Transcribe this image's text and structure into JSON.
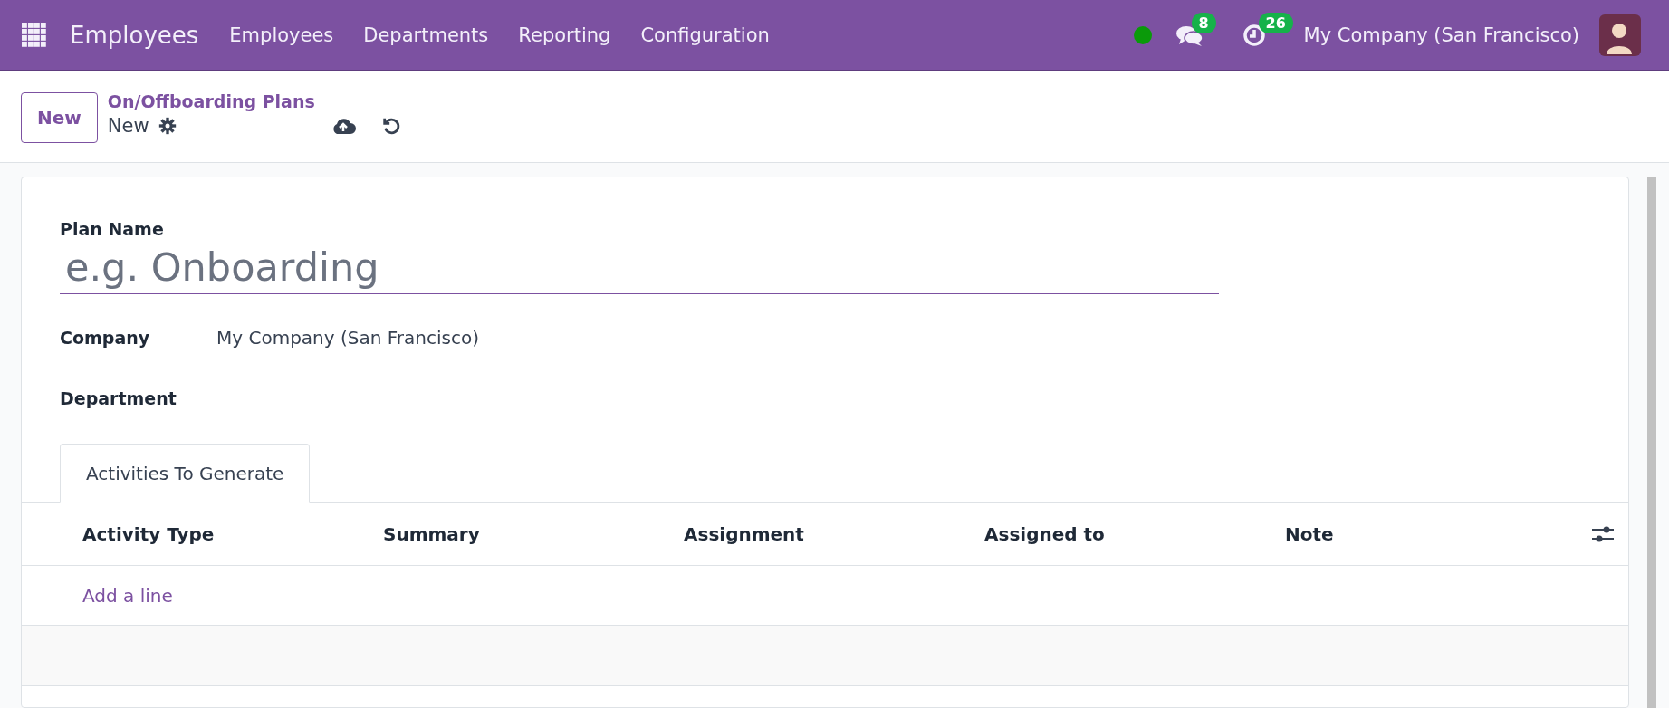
{
  "navbar": {
    "app_name": "Employees",
    "menu": [
      "Employees",
      "Departments",
      "Reporting",
      "Configuration"
    ],
    "messages_count": "8",
    "activities_count": "26",
    "company": "My Company (San Francisco)"
  },
  "control_panel": {
    "new_button": "New",
    "breadcrumb": "On/Offboarding Plans",
    "record": "New"
  },
  "form": {
    "plan_name": {
      "label": "Plan Name",
      "placeholder": "e.g. Onboarding"
    },
    "fields": [
      {
        "label": "Company",
        "value": "My Company (San Francisco)"
      },
      {
        "label": "Department"
      }
    ],
    "tabs": [
      {
        "label": "Activities To Generate",
        "selected": true
      }
    ],
    "table": {
      "columns": [
        "Activity Type",
        "Summary",
        "Assignment",
        "Assigned to",
        "Note"
      ],
      "add_line": "Add a line"
    }
  }
}
